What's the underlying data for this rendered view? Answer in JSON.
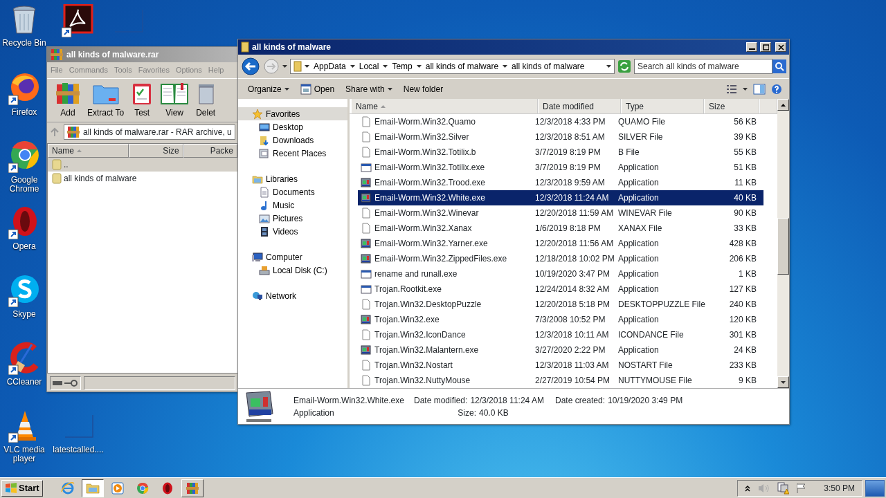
{
  "desktop": {
    "icons": [
      {
        "label": "Recycle Bin",
        "kind": "trash"
      },
      {
        "kind": "pdf"
      },
      {
        "kind": "blank"
      },
      {
        "label": "Firefox",
        "kind": "firefox"
      },
      {
        "label": "Google Chrome",
        "kind": "chrome"
      },
      {
        "label": "Opera",
        "kind": "opera"
      },
      {
        "label": "Skype",
        "kind": "skype"
      },
      {
        "label": "CCleaner",
        "kind": "ccleaner"
      },
      {
        "label": "VLC media player",
        "kind": "vlc"
      },
      {
        "label": "latestcalled....",
        "kind": "blank"
      }
    ]
  },
  "winrar": {
    "title": "all kinds of malware.rar",
    "menu": [
      "File",
      "Commands",
      "Tools",
      "Favorites",
      "Options",
      "Help"
    ],
    "toolbar": [
      {
        "label": "Add",
        "kind": "add"
      },
      {
        "label": "Extract To",
        "kind": "extract"
      },
      {
        "label": "Test",
        "kind": "test"
      },
      {
        "label": "View",
        "kind": "view"
      },
      {
        "label": "Delet",
        "kind": "delete"
      }
    ],
    "address": "all kinds of malware.rar - RAR archive, u",
    "columns": [
      {
        "label": "Name",
        "sorted": true
      },
      {
        "label": "Size",
        "sorted": false
      },
      {
        "label": "Packe",
        "sorted": false
      }
    ],
    "rows": [
      {
        "name": "..",
        "selected": true
      },
      {
        "name": "all kinds of malware",
        "selected": false
      }
    ]
  },
  "explorer": {
    "title": "all kinds of malware",
    "breadcrumb": [
      "AppData",
      "Local",
      "Temp",
      "all kinds of malware",
      "all kinds of malware"
    ],
    "search": {
      "placeholder": "Search all kinds of malware"
    },
    "toolbar": [
      {
        "label": "Organize",
        "kind": "menu"
      },
      {
        "label": "Open",
        "kind": "icon"
      },
      {
        "label": "Share with",
        "kind": "menu"
      },
      {
        "label": "New folder",
        "kind": "plain"
      }
    ],
    "nav": [
      {
        "label": "Favorites",
        "kind": "star",
        "selected": true,
        "children": [
          {
            "label": "Desktop",
            "kind": "desktop",
            "selected": false
          },
          {
            "label": "Downloads",
            "kind": "downloads",
            "selected": false
          },
          {
            "label": "Recent Places",
            "kind": "recent",
            "selected": false
          }
        ]
      },
      {
        "label": "Libraries",
        "kind": "libraries",
        "selected": false,
        "children": [
          {
            "label": "Documents",
            "kind": "documents",
            "selected": false
          },
          {
            "label": "Music",
            "kind": "music",
            "selected": false
          },
          {
            "label": "Pictures",
            "kind": "pictures",
            "selected": false
          },
          {
            "label": "Videos",
            "kind": "videos",
            "selected": false
          }
        ]
      },
      {
        "label": "Computer",
        "kind": "computer",
        "selected": false,
        "children": [
          {
            "label": "Local Disk (C:)",
            "kind": "disk",
            "selected": false
          }
        ]
      },
      {
        "label": "Network",
        "kind": "network",
        "selected": false
      }
    ],
    "columns": [
      {
        "label": "Name",
        "sorted": true
      },
      {
        "label": "Date modified",
        "sorted": false
      },
      {
        "label": "Type",
        "sorted": false
      },
      {
        "label": "Size",
        "sorted": false
      }
    ],
    "rows": [
      {
        "name": "Email-Worm.Win32.Quamo",
        "date": "12/3/2018 4:33 PM",
        "type": "QUAMO File",
        "size": "56 KB",
        "kind": "file",
        "selected": false
      },
      {
        "name": "Email-Worm.Win32.Silver",
        "date": "12/3/2018 8:51 AM",
        "type": "SILVER File",
        "size": "39 KB",
        "kind": "file",
        "selected": false
      },
      {
        "name": "Email-Worm.Win32.Totilix.b",
        "date": "3/7/2019 8:19 PM",
        "type": "B File",
        "size": "55 KB",
        "kind": "file",
        "selected": false
      },
      {
        "name": "Email-Worm.Win32.Totilix.exe",
        "date": "3/7/2019 8:19 PM",
        "type": "Application",
        "size": "51 KB",
        "kind": "app",
        "selected": false
      },
      {
        "name": "Email-Worm.Win32.Trood.exe",
        "date": "12/3/2018 9:59 AM",
        "type": "Application",
        "size": "11 KB",
        "kind": "custom",
        "selected": false
      },
      {
        "name": "Email-Worm.Win32.White.exe",
        "date": "12/3/2018 11:24 AM",
        "type": "Application",
        "size": "40 KB",
        "kind": "custom",
        "selected": true
      },
      {
        "name": "Email-Worm.Win32.Winevar",
        "date": "12/20/2018 11:59 AM",
        "type": "WINEVAR File",
        "size": "90 KB",
        "kind": "file",
        "selected": false
      },
      {
        "name": "Email-Worm.Win32.Xanax",
        "date": "1/6/2019 8:18 PM",
        "type": "XANAX File",
        "size": "33 KB",
        "kind": "file",
        "selected": false
      },
      {
        "name": "Email-Worm.Win32.Yarner.exe",
        "date": "12/20/2018 11:56 AM",
        "type": "Application",
        "size": "428 KB",
        "kind": "custom",
        "selected": false
      },
      {
        "name": "Email-Worm.Win32.ZippedFiles.exe",
        "date": "12/18/2018 10:02 PM",
        "type": "Application",
        "size": "206 KB",
        "kind": "custom",
        "selected": false
      },
      {
        "name": "rename and runall.exe",
        "date": "10/19/2020 3:47 PM",
        "type": "Application",
        "size": "1 KB",
        "kind": "app",
        "selected": false
      },
      {
        "name": "Trojan.Rootkit.exe",
        "date": "12/24/2014 8:32 AM",
        "type": "Application",
        "size": "127 KB",
        "kind": "app",
        "selected": false
      },
      {
        "name": "Trojan.Win32.DesktopPuzzle",
        "date": "12/20/2018 5:18 PM",
        "type": "DESKTOPPUZZLE File",
        "size": "240 KB",
        "kind": "file",
        "selected": false
      },
      {
        "name": "Trojan.Win32.exe",
        "date": "7/3/2008 10:52 PM",
        "type": "Application",
        "size": "120 KB",
        "kind": "custom",
        "selected": false
      },
      {
        "name": "Trojan.Win32.IconDance",
        "date": "12/3/2018 10:11 AM",
        "type": "ICONDANCE File",
        "size": "301 KB",
        "kind": "file",
        "selected": false
      },
      {
        "name": "Trojan.Win32.Malantern.exe",
        "date": "3/27/2020 2:22 PM",
        "type": "Application",
        "size": "24 KB",
        "kind": "custom",
        "selected": false
      },
      {
        "name": "Trojan.Win32.Nostart",
        "date": "12/3/2018 11:03 AM",
        "type": "NOSTART File",
        "size": "233 KB",
        "kind": "file",
        "selected": false
      },
      {
        "name": "Trojan.Win32.NuttyMouse",
        "date": "2/27/2019 10:54 PM",
        "type": "NUTTYMOUSE File",
        "size": "9 KB",
        "kind": "file",
        "selected": false
      }
    ],
    "details": {
      "name": "Email-Worm.Win32.White.exe",
      "type": "Application",
      "fields": [
        {
          "label": "Date modified:",
          "value": "12/3/2018 11:24 AM"
        },
        {
          "label": "Date created:",
          "value": "10/19/2020 3:49 PM"
        },
        {
          "label": "Size:",
          "value": "40.0 KB"
        }
      ]
    }
  },
  "taskbar": {
    "start": "Start",
    "apps": [
      {
        "kind": "ie",
        "open": false,
        "selected": false
      },
      {
        "kind": "explorer",
        "open": true,
        "selected": true
      },
      {
        "kind": "media",
        "open": false,
        "selected": false
      },
      {
        "kind": "chrome",
        "open": false,
        "selected": false
      },
      {
        "kind": "opera",
        "open": false,
        "selected": false
      },
      {
        "kind": "winrar",
        "open": true,
        "selected": false
      }
    ],
    "clock": "3:50 PM"
  }
}
